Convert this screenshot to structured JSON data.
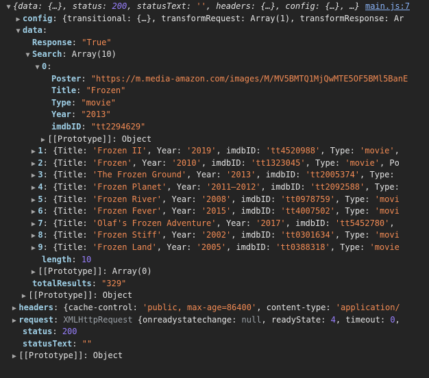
{
  "source_link": "main.js:7",
  "info_badge": "i",
  "lines": [
    {
      "indent": 0,
      "toggle": "▼",
      "html": "<span class='it plain'>{data: {…}, status: </span><span class='num it'>200</span><span class='it plain'>, statusText: </span><span class='str it'>''</span><span class='it plain'>, headers: {…}, config: {…}, …}</span>"
    },
    {
      "indent": 1,
      "toggle": "▶",
      "html": "<span class='key-b'>config</span>: {transitional: {…}, transformRequest: Array(1), transformResponse: Ar"
    },
    {
      "indent": 1,
      "toggle": "▼",
      "html": "<span class='key-b'>data</span>:"
    },
    {
      "indent": 2,
      "toggle": "",
      "html": "<span class='key-b'>Response</span>: <span class='qstr'>\"True\"</span>"
    },
    {
      "indent": 2,
      "toggle": "▼",
      "html": "<span class='key-b'>Search</span>: Array(10)"
    },
    {
      "indent": 3,
      "toggle": "▼",
      "html": "<span class='key-b'>0</span>:"
    },
    {
      "indent": 4,
      "toggle": "",
      "html": "<span class='key-b'>Poster</span>: <span class='qstr'>\"https://m.media-amazon.com/images/M/MV5BMTQ1MjQwMTE5OF5BMl5BanE</span>"
    },
    {
      "indent": 4,
      "toggle": "",
      "html": "<span class='key-b'>Title</span>: <span class='qstr'>\"Frozen\"</span>"
    },
    {
      "indent": 4,
      "toggle": "",
      "html": "<span class='key-b'>Type</span>: <span class='qstr'>\"movie\"</span>"
    },
    {
      "indent": 4,
      "toggle": "",
      "html": "<span class='key-b'>Year</span>: <span class='qstr'>\"2013\"</span>"
    },
    {
      "indent": 4,
      "toggle": "",
      "html": "<span class='key-b'>imdbID</span>: <span class='qstr'>\"tt2294629\"</span>"
    },
    {
      "indent": 3.6,
      "toggle": "▶",
      "html": "<span class='plain'>[[Prototype]]</span>: Object"
    },
    {
      "indent": 2.6,
      "toggle": "▶",
      "html": "<span class='key-b'>1</span>: {Title: <span class='str'>'Frozen II'</span>, Year: <span class='str'>'2019'</span>, imdbID: <span class='str'>'tt4520988'</span>, Type: <span class='str'>'movie'</span>,"
    },
    {
      "indent": 2.6,
      "toggle": "▶",
      "html": "<span class='key-b'>2</span>: {Title: <span class='str'>'Frozen'</span>, Year: <span class='str'>'2010'</span>, imdbID: <span class='str'>'tt1323045'</span>, Type: <span class='str'>'movie'</span>, Po"
    },
    {
      "indent": 2.6,
      "toggle": "▶",
      "html": "<span class='key-b'>3</span>: {Title: <span class='str'>'The Frozen Ground'</span>, Year: <span class='str'>'2013'</span>, imdbID: <span class='str'>'tt2005374'</span>, Type:"
    },
    {
      "indent": 2.6,
      "toggle": "▶",
      "html": "<span class='key-b'>4</span>: {Title: <span class='str'>'Frozen Planet'</span>, Year: <span class='str'>'2011–2012'</span>, imdbID: <span class='str'>'tt2092588'</span>, Type:"
    },
    {
      "indent": 2.6,
      "toggle": "▶",
      "html": "<span class='key-b'>5</span>: {Title: <span class='str'>'Frozen River'</span>, Year: <span class='str'>'2008'</span>, imdbID: <span class='str'>'tt0978759'</span>, Type: <span class='str'>'movi</span>"
    },
    {
      "indent": 2.6,
      "toggle": "▶",
      "html": "<span class='key-b'>6</span>: {Title: <span class='str'>'Frozen Fever'</span>, Year: <span class='str'>'2015'</span>, imdbID: <span class='str'>'tt4007502'</span>, Type: <span class='str'>'movi</span>"
    },
    {
      "indent": 2.6,
      "toggle": "▶",
      "html": "<span class='key-b'>7</span>: {Title: <span class='str'>'Olaf's Frozen Adventure'</span>, Year: <span class='str'>'2017'</span>, imdbID: <span class='str'>'tt5452780'</span>,"
    },
    {
      "indent": 2.6,
      "toggle": "▶",
      "html": "<span class='key-b'>8</span>: {Title: <span class='str'>'Frozen Stiff'</span>, Year: <span class='str'>'2002'</span>, imdbID: <span class='str'>'tt0301634'</span>, Type: <span class='str'>'movi</span>"
    },
    {
      "indent": 2.6,
      "toggle": "▶",
      "html": "<span class='key-b'>9</span>: {Title: <span class='str'>'Frozen Land'</span>, Year: <span class='str'>'2005'</span>, imdbID: <span class='str'>'tt0388318'</span>, Type: <span class='str'>'movie</span>"
    },
    {
      "indent": 3,
      "toggle": "",
      "html": "<span class='key-b'>length</span>: <span class='num'>10</span>"
    },
    {
      "indent": 2.6,
      "toggle": "▶",
      "html": "<span class='plain'>[[Prototype]]</span>: Array(0)"
    },
    {
      "indent": 2,
      "toggle": "",
      "html": "<span class='key-b'>totalResults</span>: <span class='qstr'>\"329\"</span>"
    },
    {
      "indent": 1.6,
      "toggle": "▶",
      "html": "<span class='plain'>[[Prototype]]</span>: Object"
    },
    {
      "indent": 0.6,
      "toggle": "▶",
      "html": "<span class='key-b'>headers</span>: {cache-control: <span class='str'>'public, max-age=86400'</span>, content-type: <span class='str'>'application/</span>"
    },
    {
      "indent": 0.6,
      "toggle": "▶",
      "html": "<span class='key-b'>request</span>: <span class='nul'>XMLHttpRequest</span> {onreadystatechange: <span class='nul'>null</span>, readyState: <span class='num'>4</span>, timeout: <span class='num'>0</span>,"
    },
    {
      "indent": 1,
      "toggle": "",
      "html": "<span class='key-b'>status</span>: <span class='num'>200</span>"
    },
    {
      "indent": 1,
      "toggle": "",
      "html": "<span class='key-b'>statusText</span>: <span class='qstr'>\"\"</span>"
    },
    {
      "indent": 0.6,
      "toggle": "▶",
      "html": "<span class='plain'>[[Prototype]]</span>: Object"
    }
  ]
}
